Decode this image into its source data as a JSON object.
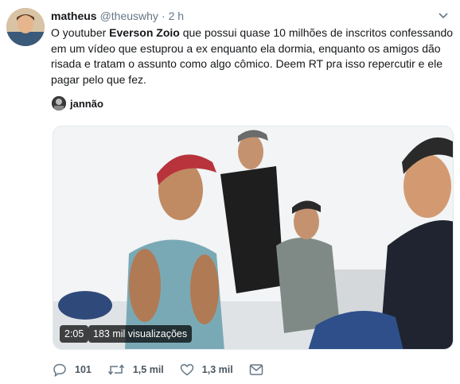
{
  "tweet": {
    "author_name": "matheus",
    "author_handle": "@theuswhy",
    "separator": "·",
    "time": "2 h",
    "text_before": "O youtuber ",
    "text_bold": "Everson Zoio",
    "text_after": " que possui quase 10 milhões de inscritos confessando em um vídeo que estuprou a ex enquanto ela dormia, enquanto os amigos dão risada e tratam o assunto como algo cômico. Deem RT pra isso repercutir e ele pagar pelo que fez."
  },
  "tagged_user": {
    "name": "jannão"
  },
  "media": {
    "duration": "2:05",
    "views": "183 mil visualizações"
  },
  "actions": {
    "reply_count": "101",
    "retweet_count": "1,5 mil",
    "like_count": "1,3 mil"
  },
  "icons": {
    "caret": "chevron-down-icon",
    "reply": "reply-icon",
    "retweet": "retweet-icon",
    "like": "heart-icon",
    "dm": "envelope-icon"
  },
  "colors": {
    "text": "#14171a",
    "muted": "#657786"
  }
}
